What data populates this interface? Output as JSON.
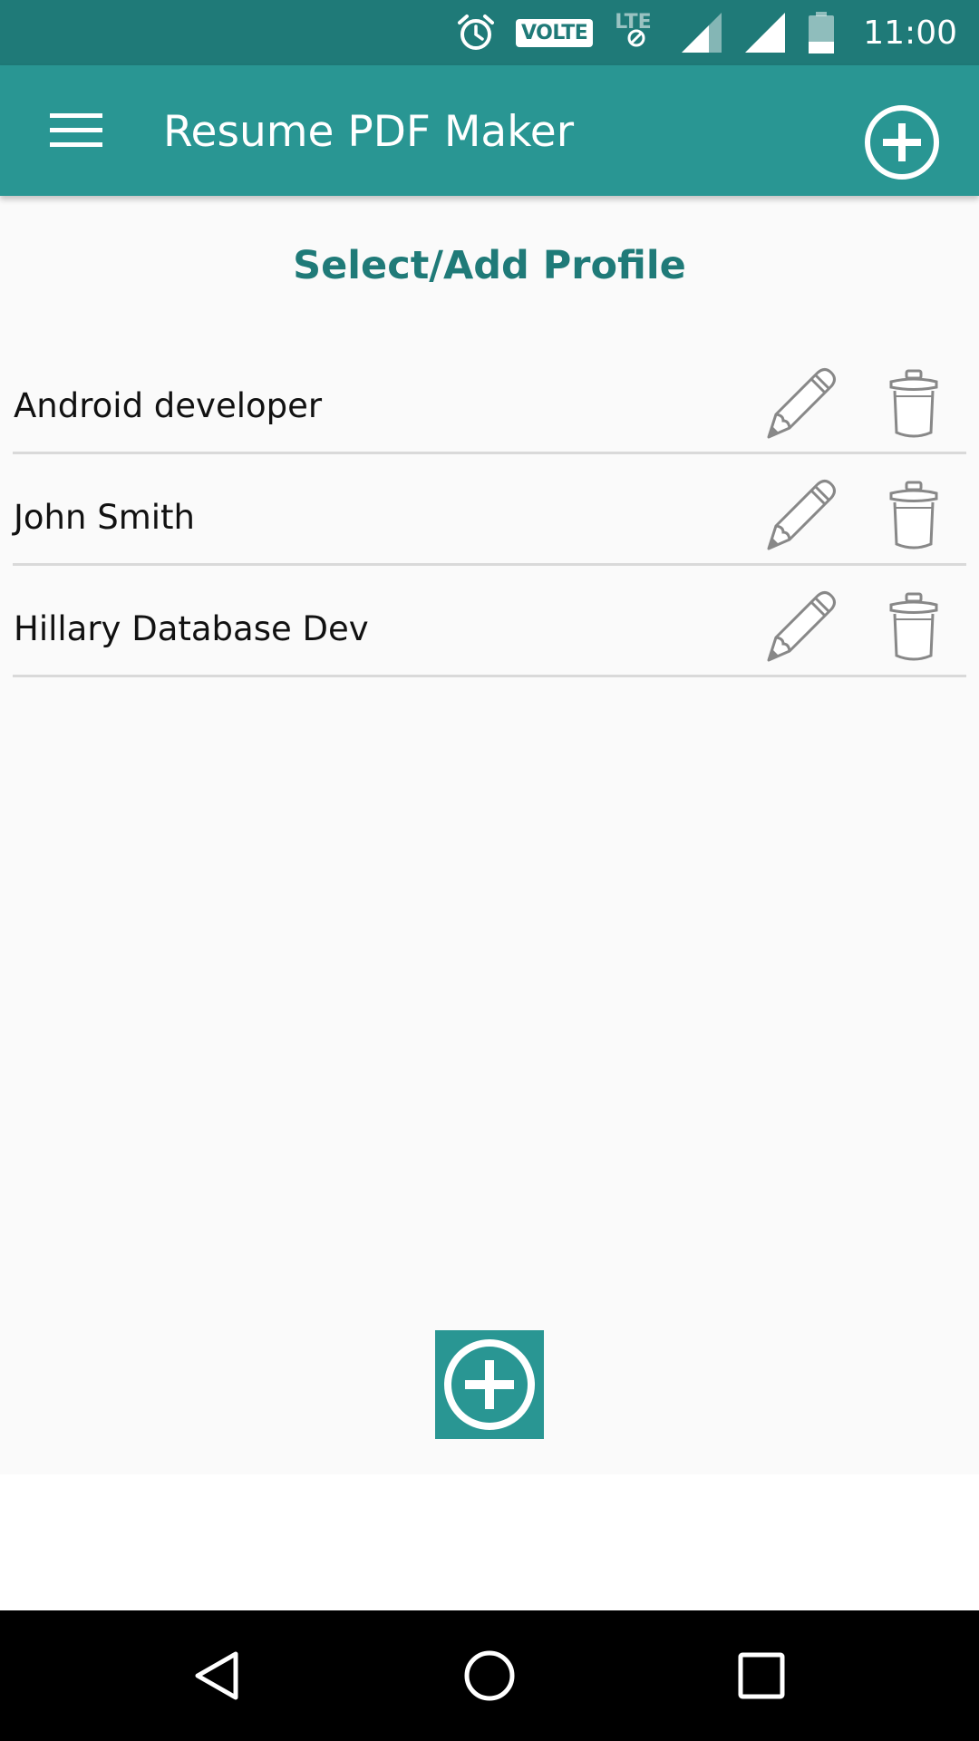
{
  "status_bar": {
    "time": "11:00",
    "volte": "VOLTE",
    "network": "LTE",
    "icons": [
      "alarm-icon",
      "volte-badge",
      "lte-icon",
      "signal-icon",
      "signal-icon",
      "battery-icon"
    ]
  },
  "app_bar": {
    "title": "Resume PDF Maker",
    "menu_icon": "hamburger-menu-icon",
    "add_icon": "add-circle-icon"
  },
  "main": {
    "section_title": "Select/Add Profile",
    "profiles": [
      {
        "name": "Android developer"
      },
      {
        "name": "John Smith"
      },
      {
        "name": "Hillary Database Dev"
      }
    ],
    "row_icons": {
      "edit": "pencil-icon",
      "delete": "trash-icon"
    },
    "add_button_icon": "add-circle-icon"
  },
  "nav_bar": {
    "icons": [
      "back-icon",
      "home-icon",
      "recents-icon"
    ]
  },
  "colors": {
    "status_bar": "#1f7a78",
    "app_bar": "#299693",
    "accent_text": "#1f7a78",
    "background": "#fafafa",
    "divider": "#d9d9d9"
  }
}
